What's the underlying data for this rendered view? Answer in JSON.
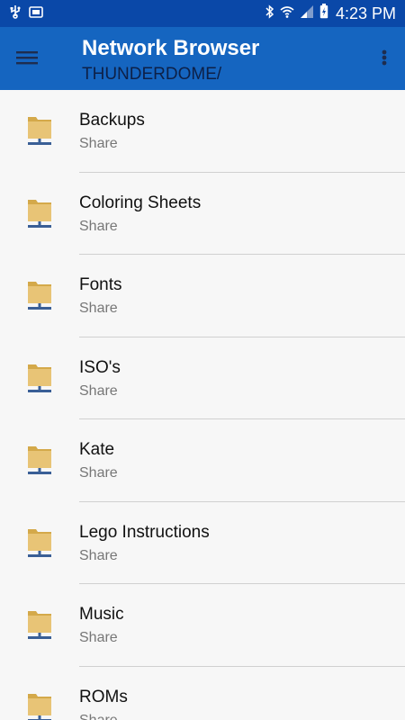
{
  "status_bar": {
    "time": "4:23 PM",
    "left_icons": [
      "usb-icon",
      "screenshot-icon"
    ],
    "right_icons": [
      "bluetooth-icon",
      "wifi-icon",
      "signal-icon",
      "battery-charging-icon"
    ]
  },
  "app_bar": {
    "title": "Network Browser",
    "subtitle": "THUNDERDOME/",
    "color": "#1565c0"
  },
  "shares": [
    {
      "name": "Backups",
      "type": "Share"
    },
    {
      "name": "Coloring Sheets",
      "type": "Share"
    },
    {
      "name": "Fonts",
      "type": "Share"
    },
    {
      "name": "ISO's",
      "type": "Share"
    },
    {
      "name": "Kate",
      "type": "Share"
    },
    {
      "name": "Lego Instructions",
      "type": "Share"
    },
    {
      "name": "Music",
      "type": "Share"
    },
    {
      "name": "ROMs",
      "type": "Share"
    }
  ]
}
